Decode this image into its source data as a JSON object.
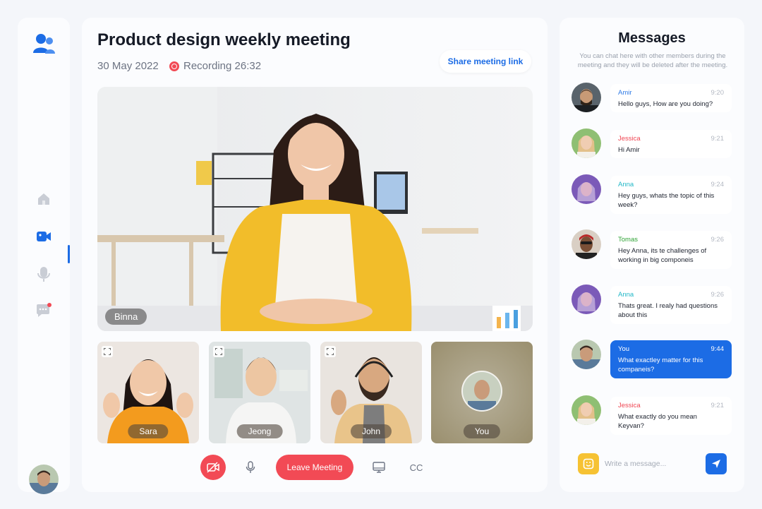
{
  "sidebar": {
    "logo": "users-logo-icon",
    "items": [
      {
        "icon": "home-icon",
        "active": false
      },
      {
        "icon": "video-camera-icon",
        "active": true
      },
      {
        "icon": "microphone-icon",
        "active": false
      },
      {
        "icon": "chat-icon",
        "active": false,
        "badge": true
      }
    ]
  },
  "meeting": {
    "title": "Product design weekly meeting",
    "date": "30 May 2022",
    "recording": "Recording 26:32",
    "share_label": "Share meeting link",
    "main_speaker": "Binna",
    "participants": [
      "Sara",
      "Jeong",
      "John",
      "You"
    ]
  },
  "controls": {
    "leave_label": "Leave Meeting",
    "cc_label": "CC"
  },
  "messages": {
    "title": "Messages",
    "subtitle": "You can chat here with other members during the meeting and they will be deleted after the meeting.",
    "items": [
      {
        "name": "Amir",
        "time": "9:20",
        "text": "Hello guys, How are you doing?",
        "color": "#2f7be6"
      },
      {
        "name": "Jessica",
        "time": "9:21",
        "text": "Hi Amir",
        "color": "#f04552"
      },
      {
        "name": "Anna",
        "time": "9:24",
        "text": "Hey guys, whats the topic of this week?",
        "color": "#20b7c7"
      },
      {
        "name": "Tomas",
        "time": "9:26",
        "text": "Hey Anna, its te challenges of working in big componeis",
        "color": "#2fa335"
      },
      {
        "name": "Anna",
        "time": "9:26",
        "text": "Thats great. I realy had questions about this",
        "color": "#20b7c7"
      },
      {
        "name": "You",
        "time": "9:44",
        "text": "What exactley matter for this companeis?",
        "color": "#ffffff"
      },
      {
        "name": "Jessica",
        "time": "9:21",
        "text": "What exactly do you mean Keyvan?",
        "color": "#f04552"
      }
    ],
    "input_placeholder": "Write a message..."
  },
  "colors": {
    "accent": "#1c6ce5",
    "danger": "#f24a55"
  }
}
